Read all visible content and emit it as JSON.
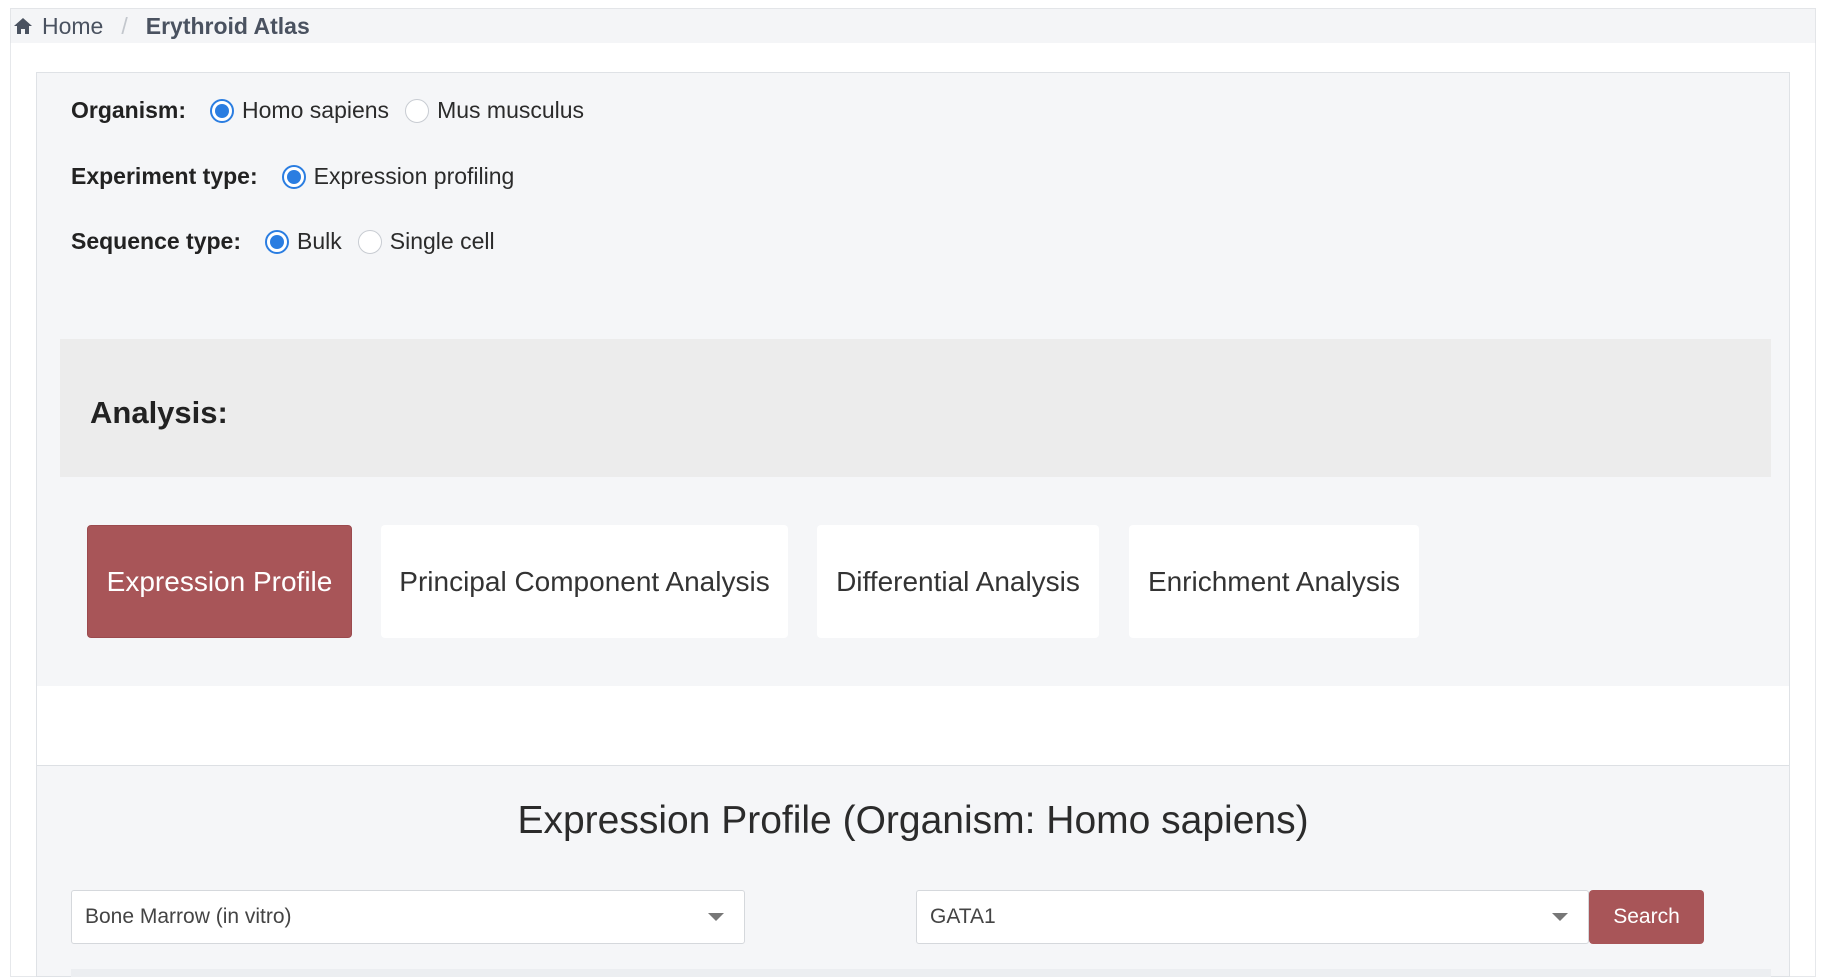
{
  "breadcrumb": {
    "home_icon": "home-icon",
    "home": "Home",
    "separator": "/",
    "current": "Erythroid Atlas"
  },
  "form": {
    "organism": {
      "label": "Organism:",
      "options": [
        {
          "label": "Homo sapiens",
          "checked": true
        },
        {
          "label": "Mus musculus",
          "checked": false
        }
      ]
    },
    "experiment_type": {
      "label": "Experiment type:",
      "options": [
        {
          "label": "Expression profiling",
          "checked": true
        }
      ]
    },
    "sequence_type": {
      "label": "Sequence type:",
      "options": [
        {
          "label": "Bulk",
          "checked": true
        },
        {
          "label": "Single cell",
          "checked": false
        }
      ]
    }
  },
  "analysis": {
    "title": "Analysis:",
    "tabs": [
      {
        "label": "Expression Profile",
        "active": true
      },
      {
        "label": "Principal Component Analysis",
        "active": false
      },
      {
        "label": "Differential Analysis",
        "active": false
      },
      {
        "label": "Enrichment Analysis",
        "active": false
      }
    ]
  },
  "section": {
    "title": "Expression Profile (Organism: Homo sapiens)",
    "tissue_select": {
      "value": "Bone Marrow (in vitro)"
    },
    "gene_select": {
      "value": "GATA1"
    },
    "search_label": "Search"
  },
  "colors": {
    "accent": "#a85558",
    "radio_checked": "#2a7de1",
    "panel_bg": "#f5f6f8"
  }
}
